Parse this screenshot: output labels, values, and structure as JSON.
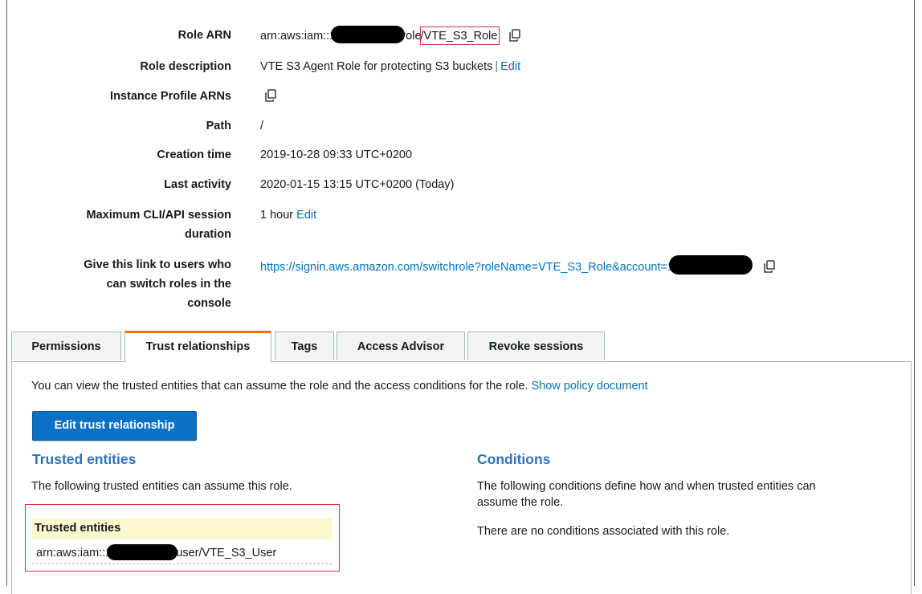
{
  "summary": {
    "role_arn": {
      "label": "Role ARN",
      "prefix": "arn:aws:iam::1",
      "mid": ":role",
      "name": "/VTE_S3_Role"
    },
    "role_description": {
      "label": "Role description",
      "value": "VTE S3 Agent Role for protecting S3 buckets",
      "separator": "|",
      "edit": "Edit"
    },
    "instance_profile": {
      "label": "Instance Profile ARNs"
    },
    "path": {
      "label": "Path",
      "value": "/"
    },
    "creation_time": {
      "label": "Creation time",
      "value": "2019-10-28 09:33 UTC+0200"
    },
    "last_activity": {
      "label": "Last activity",
      "value": "2020-01-15 13:15 UTC+0200 (Today)"
    },
    "max_session": {
      "label_line1": "Maximum CLI/API session",
      "label_line2": "duration",
      "value": "1 hour",
      "edit": "Edit"
    },
    "switch_link": {
      "label_line1": "Give this link to users who",
      "label_line2": "can switch roles in the",
      "label_line3": "console",
      "url": "https://signin.aws.amazon.com/switchrole?roleName=VTE_S3_Role&account=1"
    }
  },
  "tabs": [
    {
      "label": "Permissions",
      "active": false
    },
    {
      "label": "Trust relationships",
      "active": true
    },
    {
      "label": "Tags",
      "active": false
    },
    {
      "label": "Access Advisor",
      "active": false
    },
    {
      "label": "Revoke sessions",
      "active": false
    }
  ],
  "trust": {
    "intro": "You can view the trusted entities that can assume the role and the access conditions for the role.",
    "show_policy": "Show policy document",
    "edit_button": "Edit trust relationship",
    "entities_heading": "Trusted entities",
    "entities_desc": "The following trusted entities can assume this role.",
    "table_header": "Trusted entities",
    "entity_prefix": "arn:aws:iam::1",
    "entity_suffix": ":user/VTE_S3_User",
    "conditions_heading": "Conditions",
    "conditions_desc_line1": "The following conditions define how and when trusted entities can",
    "conditions_desc_line2": "assume the role.",
    "conditions_none": "There are no conditions associated with this role."
  },
  "colors": {
    "link": "#0073bb",
    "primary_button": "#0b71c4",
    "section_heading": "#2e73b8",
    "active_tab_accent": "#ec7211",
    "highlight_box": "#e0303a",
    "table_header_bg": "#fdf7d0"
  }
}
